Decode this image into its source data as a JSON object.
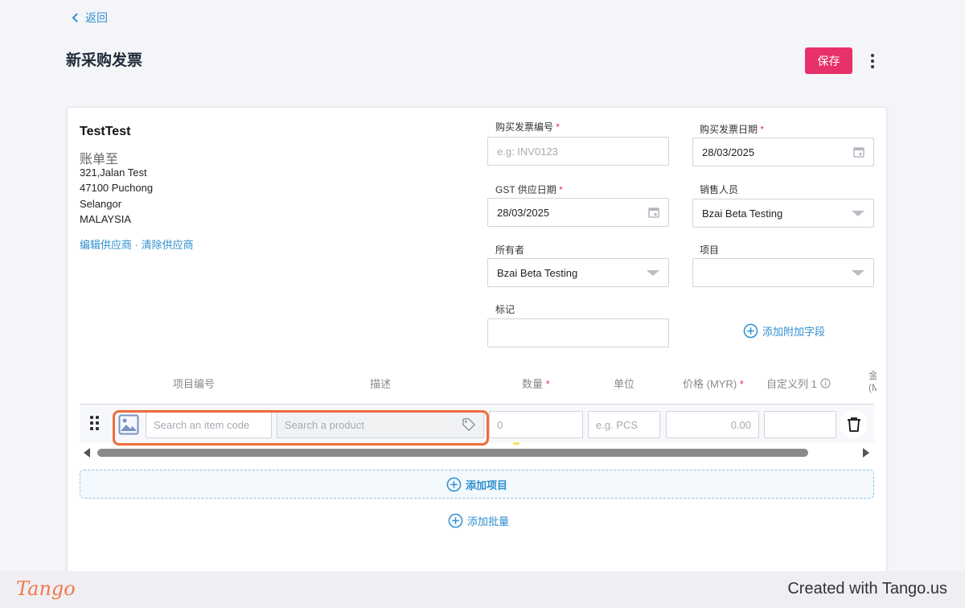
{
  "nav": {
    "back_label": "返回"
  },
  "header": {
    "title": "新采购发票",
    "save_label": "保存"
  },
  "supplier": {
    "name": "TestTest",
    "bill_to_label": "账单至",
    "address_lines": [
      "321,Jalan Test",
      "47100 Puchong",
      "Selangor",
      "MALAYSIA"
    ],
    "edit_link": "编辑供应商",
    "separator": " · ",
    "clear_link": "清除供应商"
  },
  "form": {
    "invoice_no": {
      "label": "购买发票编号",
      "placeholder": "e.g: INV0123",
      "value": ""
    },
    "invoice_date": {
      "label": "购买发票日期",
      "value": "28/03/2025"
    },
    "gst_date": {
      "label": "GST 供应日期",
      "value": "28/03/2025"
    },
    "salesperson": {
      "label": "销售人员",
      "value": "Bzai Beta Testing"
    },
    "owner": {
      "label": "所有者",
      "value": "Bzai Beta Testing"
    },
    "project": {
      "label": "项目",
      "value": ""
    },
    "tag": {
      "label": "标记",
      "value": ""
    },
    "add_field_label": "添加附加字段",
    "required_mark": "*"
  },
  "table": {
    "headers": {
      "item_code": "项目编号",
      "description": "描述",
      "quantity": "数量",
      "unit": "单位",
      "price": "价格 (MYR)",
      "custom1": "自定义列 1",
      "amount_cut": "金",
      "amount_cut2": "(M"
    },
    "row": {
      "item_code_placeholder": "Search an item code",
      "product_placeholder": "Search a product",
      "quantity_placeholder": "0",
      "unit_placeholder": "e.g. PCS",
      "price_placeholder": "0.00",
      "custom1_value": ""
    },
    "add_item_label": "添加项目",
    "add_batch_label": "添加批量"
  },
  "footer": {
    "logo": "Tango",
    "credit": "Created with Tango.us"
  },
  "colors": {
    "accent": "#2f8fd0",
    "save": "#e8316a",
    "highlight": "#ef6c3a"
  }
}
